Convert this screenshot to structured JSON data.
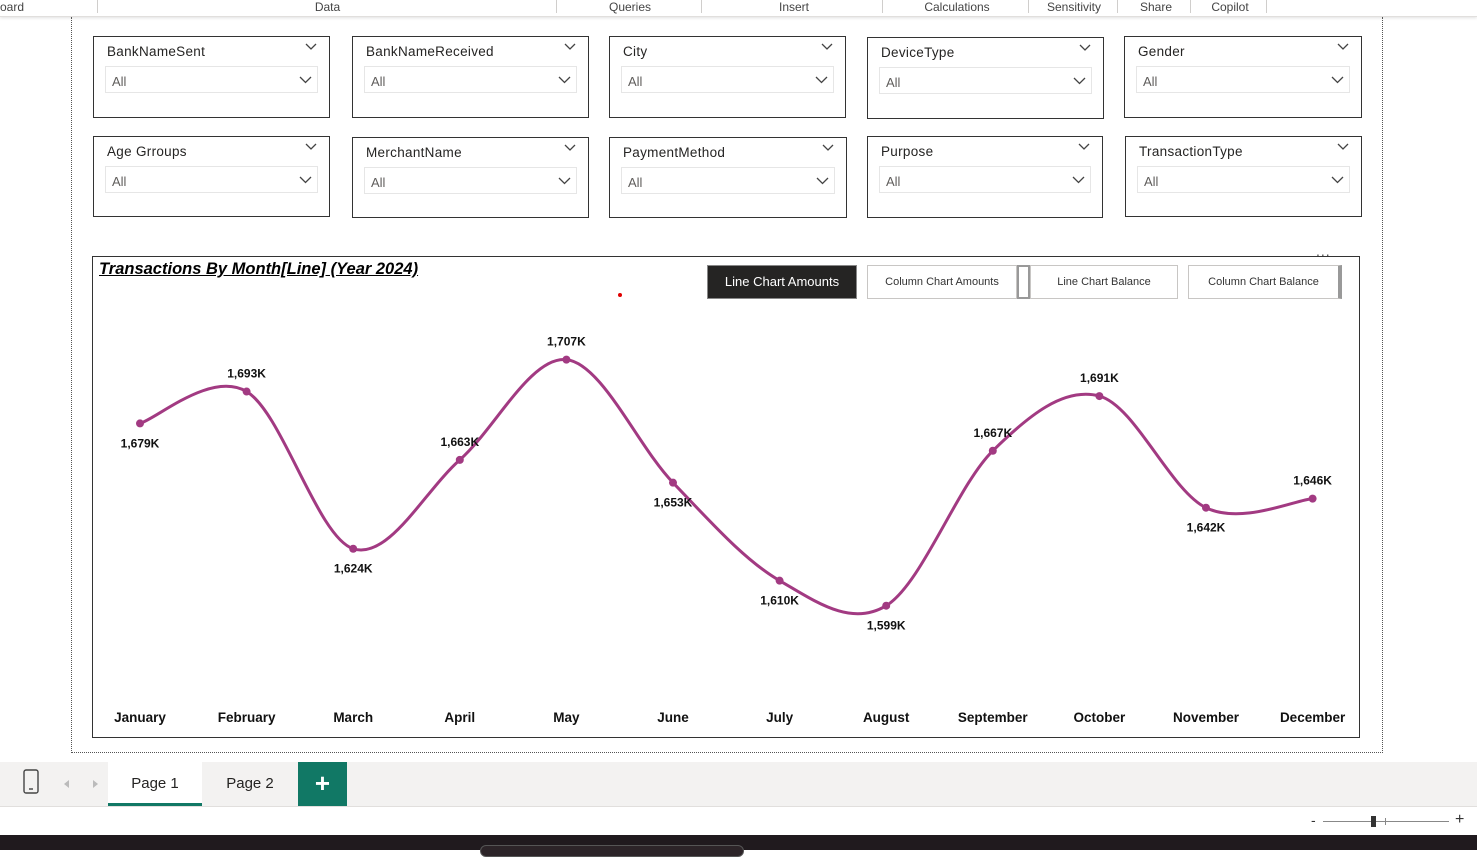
{
  "ribbon": {
    "tabs": [
      {
        "label": "oard"
      },
      {
        "label": "Data"
      },
      {
        "label": "Queries"
      },
      {
        "label": "Insert"
      },
      {
        "label": "Calculations"
      },
      {
        "label": "Sensitivity"
      },
      {
        "label": "Share"
      },
      {
        "label": "Copilot"
      }
    ]
  },
  "slicers": [
    {
      "title": "BankNameSent",
      "value": "All"
    },
    {
      "title": "BankNameReceived",
      "value": "All"
    },
    {
      "title": "City",
      "value": "All"
    },
    {
      "title": "DeviceType",
      "value": "All"
    },
    {
      "title": "Gender",
      "value": "All"
    },
    {
      "title": "Age Grroups",
      "value": "All"
    },
    {
      "title": "MerchantName",
      "value": "All"
    },
    {
      "title": "PaymentMethod",
      "value": "All"
    },
    {
      "title": "Purpose",
      "value": "All"
    },
    {
      "title": "TransactionType",
      "value": "All"
    }
  ],
  "visual": {
    "title": "Transactions By Month[Line] (Year 2024)",
    "more_label": "...",
    "buttons": [
      {
        "label": "Line Chart Amounts",
        "active": true
      },
      {
        "label": "Column Chart Amounts",
        "active": false
      },
      {
        "label": "Line Chart Balance",
        "active": false
      },
      {
        "label": "Column Chart Balance",
        "active": false
      }
    ]
  },
  "chart_data": {
    "type": "line",
    "title": "Transactions By Month[Line] (Year 2024)",
    "categories": [
      "January",
      "February",
      "March",
      "April",
      "May",
      "June",
      "July",
      "August",
      "September",
      "October",
      "November",
      "December"
    ],
    "values": [
      1679,
      1693,
      1624,
      1663,
      1707,
      1653,
      1610,
      1599,
      1667,
      1691,
      1642,
      1646
    ],
    "data_labels": [
      "1,679K",
      "1,693K",
      "1,624K",
      "1,663K",
      "1,707K",
      "1,653K",
      "1,610K",
      "1,599K",
      "1,667K",
      "1,691K",
      "1,642K",
      "1,646K"
    ],
    "unit": "K",
    "color": "#a23a82",
    "ylim": [
      1580,
      1720
    ],
    "grid": false,
    "legend": "none"
  },
  "pages": {
    "tabs": [
      {
        "label": "Page 1",
        "active": true
      },
      {
        "label": "Page 2",
        "active": false
      }
    ],
    "add_label": "+"
  },
  "status": {
    "zoom_minus": "-",
    "zoom_plus": "+"
  },
  "colors": {
    "accent": "#117865",
    "series": "#a23a82",
    "active_button": "#252423"
  }
}
